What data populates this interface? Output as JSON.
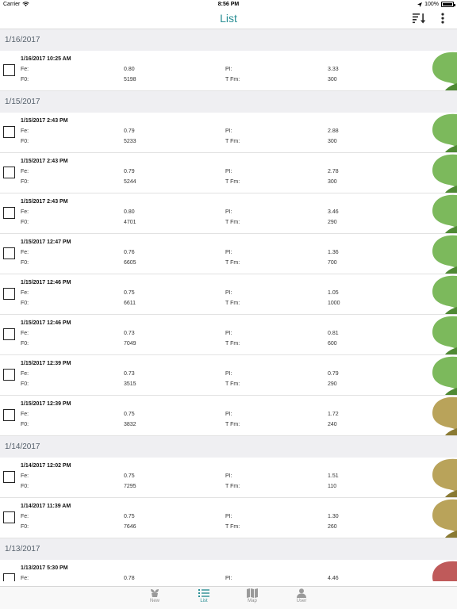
{
  "status": {
    "carrier": "Carrier",
    "time": "8:56 PM",
    "battery": "100%"
  },
  "nav": {
    "title": "List",
    "sort_icon": "sort-icon",
    "more_icon": "more-vertical-icon"
  },
  "labels": {
    "fe": "Fe:",
    "pi": "PI:",
    "f0": "F0:",
    "tfm": "T Fm:"
  },
  "colors": {
    "accent": "#2a8f95",
    "leaf_green": "#7cb95c",
    "leaf_green_dark": "#4f8a34",
    "leaf_tan": "#b9a35a",
    "leaf_tan_dark": "#8a7a33",
    "leaf_red": "#bf5a5a"
  },
  "groups": [
    {
      "date": "1/16/2017",
      "items": [
        {
          "timestamp": "1/16/2017 10:25 AM",
          "fe": "0.80",
          "pi": "3.33",
          "f0": "5198",
          "tfm": "300",
          "status": "green"
        }
      ]
    },
    {
      "date": "1/15/2017",
      "items": [
        {
          "timestamp": "1/15/2017 2:43 PM",
          "fe": "0.79",
          "pi": "2.88",
          "f0": "5233",
          "tfm": "300",
          "status": "green"
        },
        {
          "timestamp": "1/15/2017 2:43 PM",
          "fe": "0.79",
          "pi": "2.78",
          "f0": "5244",
          "tfm": "300",
          "status": "green"
        },
        {
          "timestamp": "1/15/2017 2:43 PM",
          "fe": "0.80",
          "pi": "3.46",
          "f0": "4701",
          "tfm": "290",
          "status": "green"
        },
        {
          "timestamp": "1/15/2017 12:47 PM",
          "fe": "0.76",
          "pi": "1.36",
          "f0": "6605",
          "tfm": "700",
          "status": "green"
        },
        {
          "timestamp": "1/15/2017 12:46 PM",
          "fe": "0.75",
          "pi": "1.05",
          "f0": "6611",
          "tfm": "1000",
          "status": "green"
        },
        {
          "timestamp": "1/15/2017 12:46 PM",
          "fe": "0.73",
          "pi": "0.81",
          "f0": "7049",
          "tfm": "600",
          "status": "green"
        },
        {
          "timestamp": "1/15/2017 12:39 PM",
          "fe": "0.73",
          "pi": "0.79",
          "f0": "3515",
          "tfm": "290",
          "status": "green"
        },
        {
          "timestamp": "1/15/2017 12:39 PM",
          "fe": "0.75",
          "pi": "1.72",
          "f0": "3832",
          "tfm": "240",
          "status": "tan"
        }
      ]
    },
    {
      "date": "1/14/2017",
      "items": [
        {
          "timestamp": "1/14/2017 12:02 PM",
          "fe": "0.75",
          "pi": "1.51",
          "f0": "7295",
          "tfm": "110",
          "status": "tan"
        },
        {
          "timestamp": "1/14/2017 11:39 AM",
          "fe": "0.75",
          "pi": "1.30",
          "f0": "7646",
          "tfm": "260",
          "status": "tan"
        }
      ]
    },
    {
      "date": "1/13/2017",
      "items": [
        {
          "timestamp": "1/13/2017 5:30 PM",
          "fe": "0.78",
          "pi": "4.46",
          "f0": "",
          "tfm": "",
          "status": "red"
        }
      ]
    }
  ],
  "tabs": [
    {
      "label": "New",
      "icon": "plant-icon",
      "active": false
    },
    {
      "label": "List",
      "icon": "list-icon",
      "active": true
    },
    {
      "label": "Map",
      "icon": "map-icon",
      "active": false
    },
    {
      "label": "User",
      "icon": "user-icon",
      "active": false
    }
  ]
}
